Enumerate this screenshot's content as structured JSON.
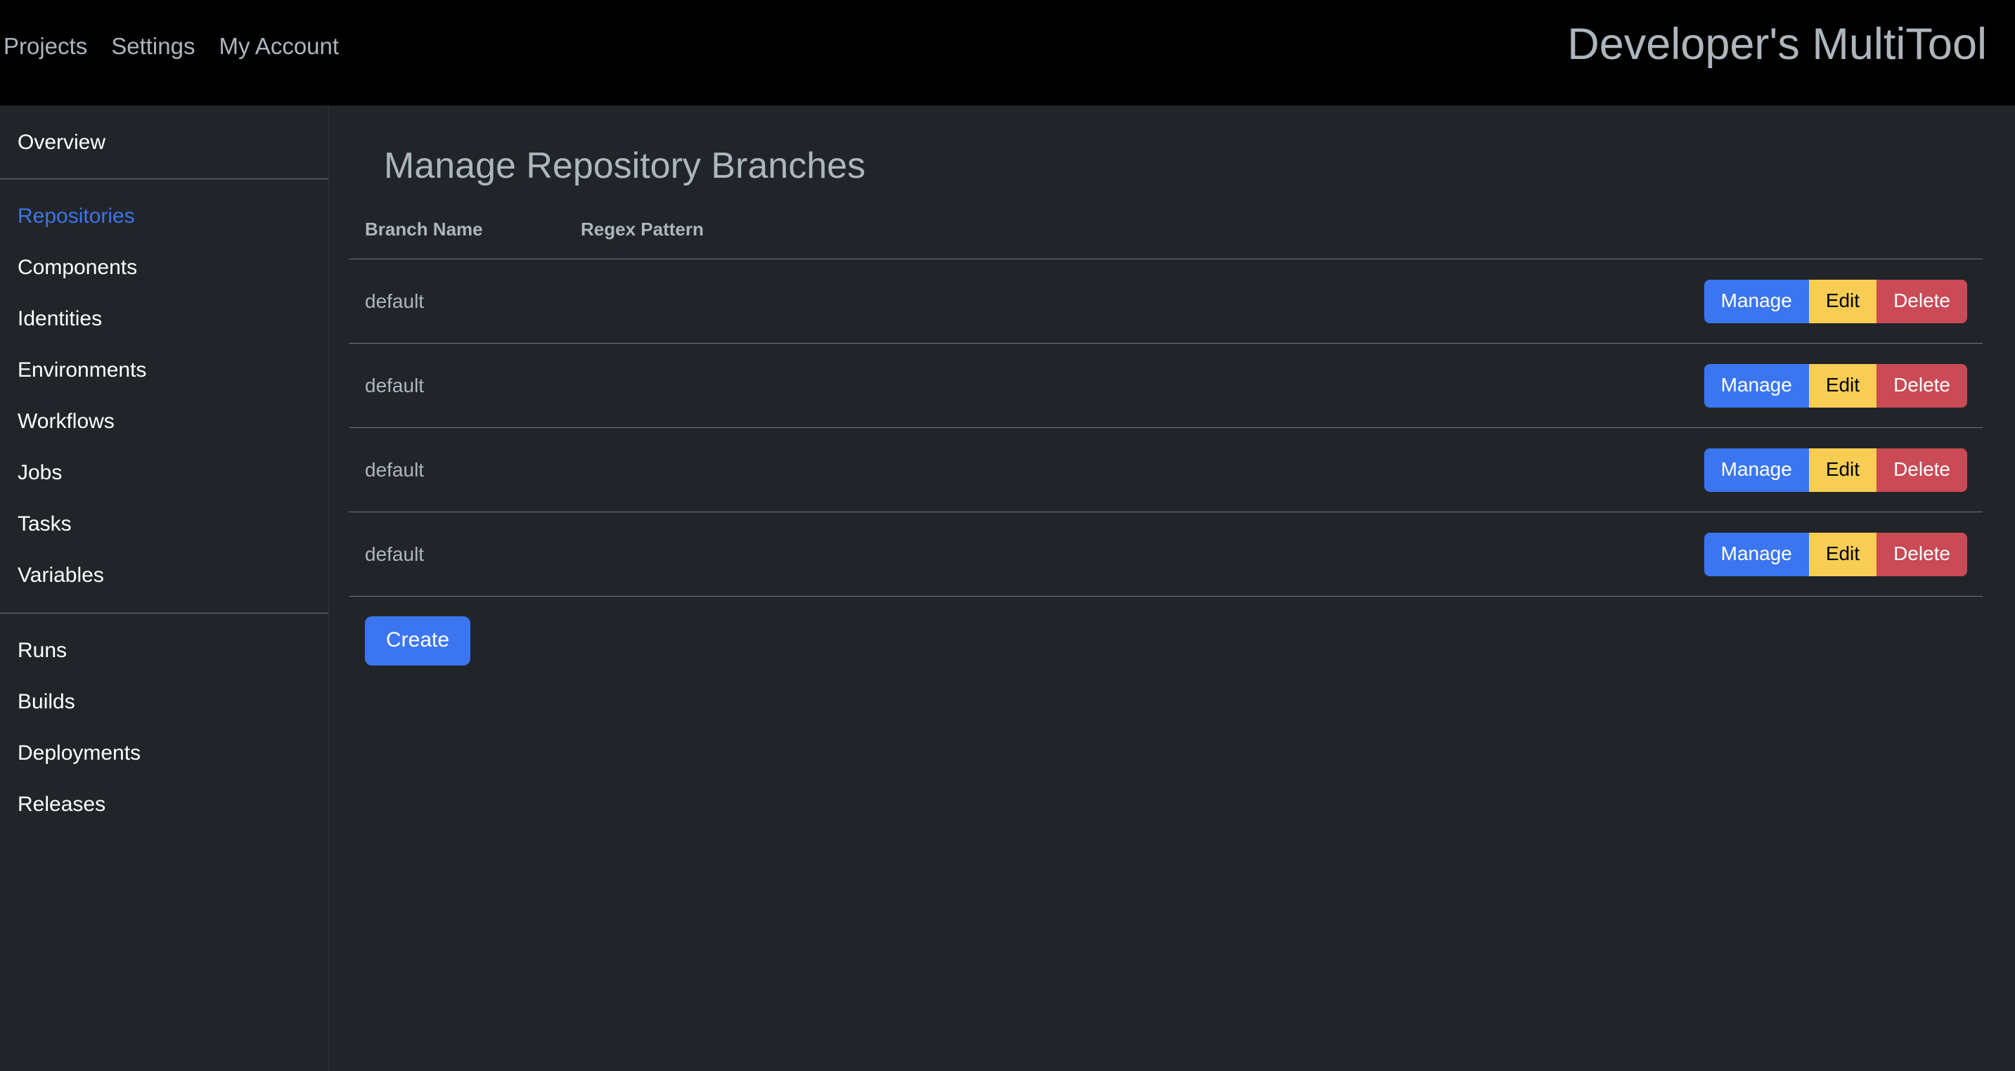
{
  "header": {
    "brand": "Developer's MultiTool",
    "nav": [
      {
        "label": "Projects"
      },
      {
        "label": "Settings"
      },
      {
        "label": "My Account"
      }
    ]
  },
  "sidebar": {
    "groups": [
      {
        "items": [
          {
            "label": "Overview",
            "active": false
          }
        ]
      },
      {
        "items": [
          {
            "label": "Repositories",
            "active": true
          },
          {
            "label": "Components",
            "active": false
          },
          {
            "label": "Identities",
            "active": false
          },
          {
            "label": "Environments",
            "active": false
          },
          {
            "label": "Workflows",
            "active": false
          },
          {
            "label": "Jobs",
            "active": false
          },
          {
            "label": "Tasks",
            "active": false
          },
          {
            "label": "Variables",
            "active": false
          }
        ]
      },
      {
        "items": [
          {
            "label": "Runs",
            "active": false
          },
          {
            "label": "Builds",
            "active": false
          },
          {
            "label": "Deployments",
            "active": false
          },
          {
            "label": "Releases",
            "active": false
          }
        ]
      }
    ]
  },
  "main": {
    "page_title": "Manage Repository Branches",
    "table": {
      "columns": [
        "Branch Name",
        "Regex Pattern",
        ""
      ],
      "rows": [
        {
          "branch_name": "default",
          "regex_pattern": ""
        },
        {
          "branch_name": "default",
          "regex_pattern": ""
        },
        {
          "branch_name": "default",
          "regex_pattern": ""
        },
        {
          "branch_name": "default",
          "regex_pattern": ""
        }
      ],
      "row_actions": [
        {
          "label": "Manage",
          "kind": "manage"
        },
        {
          "label": "Edit",
          "kind": "edit"
        },
        {
          "label": "Delete",
          "kind": "delete"
        }
      ]
    },
    "create_label": "Create"
  },
  "colors": {
    "page_background": "#212529",
    "header_background": "#000000",
    "accent_blue": "#3b76f0",
    "sidebar_active": "#3d74e8",
    "edit_yellow": "#f7cd53",
    "delete_red": "#ca4a55",
    "muted_text": "#adb5bd",
    "divider": "#6c757d"
  }
}
